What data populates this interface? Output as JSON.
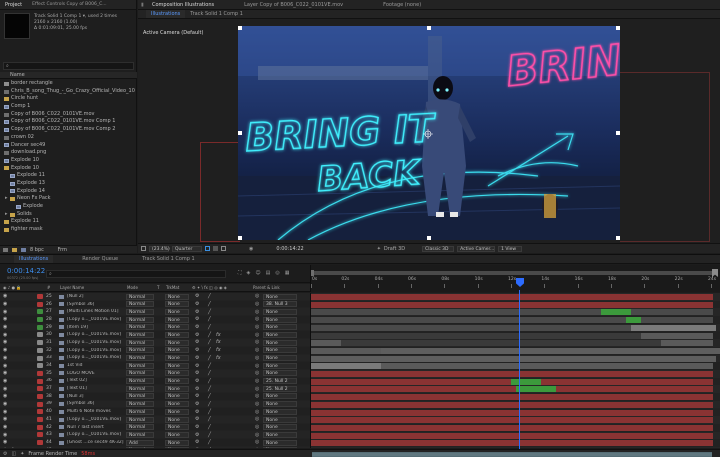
{
  "project_panel": {
    "tabs": [
      "Project",
      "Effect Controls Copy of B006_C..."
    ],
    "info": [
      "Track Solid 1 Comp 1 ▾, used 2 times",
      "2160 x 2160 (1.00)",
      "Δ 0:01:09:01, 25.00 fps"
    ],
    "search_placeholder": "",
    "column_name": "Name",
    "items": [
      {
        "name": "border rectangle",
        "type": "solid",
        "indent": 0
      },
      {
        "name": "Chris_B_song_Thug_-_Go_Crazy_Official_Video_100...",
        "type": "foot",
        "indent": 0
      },
      {
        "name": "Circle hunt",
        "type": "folder",
        "indent": 0
      },
      {
        "name": "Comp 1",
        "type": "comp",
        "indent": 0
      },
      {
        "name": "Copy of B006_C022_0101VE.mov",
        "type": "foot",
        "indent": 0
      },
      {
        "name": "Copy of B006_C022_0101VE.mov Comp 1",
        "type": "comp",
        "indent": 0
      },
      {
        "name": "Copy of B006_C022_0101VE.mov Comp 2",
        "type": "comp",
        "indent": 0
      },
      {
        "name": "crown 02",
        "type": "foot",
        "indent": 0
      },
      {
        "name": "Dancer sec49",
        "type": "comp",
        "indent": 0
      },
      {
        "name": "download.png",
        "type": "foot",
        "indent": 0
      },
      {
        "name": "Explode 10",
        "type": "comp",
        "indent": 0
      },
      {
        "name": "Explode 10",
        "type": "folder",
        "indent": 0
      },
      {
        "name": "Explode 11",
        "type": "comp",
        "indent": 1
      },
      {
        "name": "Explode 13",
        "type": "comp",
        "indent": 1
      },
      {
        "name": "Explode 14",
        "type": "comp",
        "indent": 1
      },
      {
        "name": "Neon Fx Pack",
        "type": "folder",
        "indent": 1
      },
      {
        "name": "Explode",
        "type": "comp",
        "indent": 2
      },
      {
        "name": "Solids",
        "type": "folder",
        "indent": 1
      },
      {
        "name": "Explode 11",
        "type": "folder",
        "indent": 0
      },
      {
        "name": "fighter mask",
        "type": "folder",
        "indent": 0
      }
    ],
    "footer": {
      "bpc": "8 bpc",
      "fps_label": "Frm"
    }
  },
  "comp_panel": {
    "tabs": [
      "Composition Illustrations",
      "Layer Copy of B006_C022_0101VE.mov",
      "Footage (none)"
    ],
    "subtabs": [
      "Illustrations",
      "Track Solid 1 Comp 1"
    ],
    "camera_label": "Active Camera (Default)",
    "neon_text_pink": "BRING IT",
    "neon_text_cyan_1": "BRING IT",
    "neon_text_cyan_2": "BACK",
    "toolbar": {
      "zoom": "(23.4%)",
      "quality": "Quarter",
      "timecode": "0:00:14:22",
      "renderer": "Draft 3D",
      "renderer2": "Classic 3D",
      "camera": "Active Camer...",
      "view": "1 View"
    }
  },
  "timeline": {
    "tabs": [
      "Illustrations",
      "Render Queue",
      "Track Solid 1 Comp 1"
    ],
    "current_time": "0:00:14:22",
    "current_time_sub": "00372 (25.00 fps)",
    "columns": [
      "#",
      "Layer Name",
      "Mode",
      "T",
      "TrkMat",
      "Parent & Link"
    ],
    "ruler": [
      "0s",
      "02s",
      "04s",
      "06s",
      "08s",
      "10s",
      "12s",
      "14s",
      "16s",
      "18s",
      "20s",
      "22s",
      "24s"
    ],
    "layers": [
      {
        "num": "25",
        "name": "[Null 2]",
        "mode": "Normal",
        "trkmat": "None",
        "parent": "None",
        "color": "#b03838",
        "bar": "#8a3333"
      },
      {
        "num": "26",
        "name": "[Symbol 36]",
        "mode": "Normal",
        "trkmat": "None",
        "parent": "38. Null 3",
        "color": "#b03838",
        "bar": "#8a3333"
      },
      {
        "num": "27",
        "name": "[Multi Lines Motion 01]",
        "mode": "Normal",
        "trkmat": "None",
        "parent": "None",
        "color": "#3e8e3e",
        "bar": "#4a4a4a"
      },
      {
        "num": "28",
        "name": "[Copy o..._0101VE.mov]",
        "mode": "Normal",
        "trkmat": "None",
        "parent": "None",
        "color": "#3e8e3e",
        "bar": "#4a4a4a"
      },
      {
        "num": "29",
        "name": "[Item 19]",
        "mode": "Normal",
        "trkmat": "None",
        "parent": "None",
        "color": "#3e8e3e",
        "bar": "#4a4a4a"
      },
      {
        "num": "30",
        "name": "[Copy o..._0101VE.mov]",
        "mode": "Normal",
        "trkmat": "None",
        "parent": "None",
        "color": "#8a8a8a",
        "bar": "#5a5a5a"
      },
      {
        "num": "31",
        "name": "[Copy o..._0101VE.mov]",
        "mode": "Normal",
        "trkmat": "None",
        "parent": "None",
        "color": "#8a8a8a",
        "bar": "#5a5a5a"
      },
      {
        "num": "32",
        "name": "[Copy o..._0101VE.mov]",
        "mode": "Normal",
        "trkmat": "None",
        "parent": "None",
        "color": "#8a8a8a",
        "bar": "#5a5a5a"
      },
      {
        "num": "33",
        "name": "[Copy o..._0101VE.mov]",
        "mode": "Normal",
        "trkmat": "None",
        "parent": "None",
        "color": "#8a8a8a",
        "bar": "#5a5a5a"
      },
      {
        "num": "34",
        "name": "1st Vid",
        "mode": "Normal",
        "trkmat": "None",
        "parent": "None",
        "color": "#8a8a8a",
        "bar": "#5a5a5a"
      },
      {
        "num": "35",
        "name": "LOGO MOVE",
        "mode": "Normal",
        "trkmat": "None",
        "parent": "None",
        "color": "#b03838",
        "bar": "#8a3333"
      },
      {
        "num": "36",
        "name": "[Text 02]",
        "mode": "Normal",
        "trkmat": "None",
        "parent": "25. Null 2",
        "color": "#b03838",
        "bar": "#8a3333"
      },
      {
        "num": "37",
        "name": "[Text 01]",
        "mode": "Normal",
        "trkmat": "None",
        "parent": "25. Null 2",
        "color": "#b03838",
        "bar": "#8a3333"
      },
      {
        "num": "38",
        "name": "[Null 3]",
        "mode": "Normal",
        "trkmat": "None",
        "parent": "None",
        "color": "#b03838",
        "bar": "#8a3333"
      },
      {
        "num": "39",
        "name": "[Symbol 36]",
        "mode": "Normal",
        "trkmat": "None",
        "parent": "None",
        "color": "#b03838",
        "bar": "#8a3333"
      },
      {
        "num": "40",
        "name": "Multi 6 Note moves",
        "mode": "Normal",
        "trkmat": "None",
        "parent": "None",
        "color": "#b03838",
        "bar": "#8a3333"
      },
      {
        "num": "41",
        "name": "[Copy o..._0101VE.mov]",
        "mode": "Normal",
        "trkmat": "None",
        "parent": "None",
        "color": "#b03838",
        "bar": "#8a3333"
      },
      {
        "num": "42",
        "name": "Null 7 last insert",
        "mode": "Normal",
        "trkmat": "None",
        "parent": "None",
        "color": "#b03838",
        "bar": "#8a3333"
      },
      {
        "num": "43",
        "name": "[Copy o..._0101VE.mov]",
        "mode": "Normal",
        "trkmat": "None",
        "parent": "None",
        "color": "#b03838",
        "bar": "#8a3333"
      },
      {
        "num": "44",
        "name": "[Ghost ...ce sec49 4K-32]",
        "mode": "Add",
        "trkmat": "None",
        "parent": "None",
        "color": "#b03838",
        "bar": "#8a3333"
      },
      {
        "num": "45",
        "name": "[Dancer sec49]",
        "mode": "Normal",
        "trkmat": "None",
        "parent": "None",
        "color": "#b03838",
        "bar": "#8a3333"
      },
      {
        "num": "46",
        "name": "[Copy o..._0101VE.mov]",
        "mode": "Normal",
        "trkmat": "None",
        "parent": "None",
        "color": "#8a8a8a",
        "bar": "#5a5a5a"
      }
    ],
    "footer_label": "Frame Render Time",
    "footer_value": "58ms"
  },
  "colors": {
    "accent": "#2d8ceb",
    "playhead": "#2d6cff"
  }
}
